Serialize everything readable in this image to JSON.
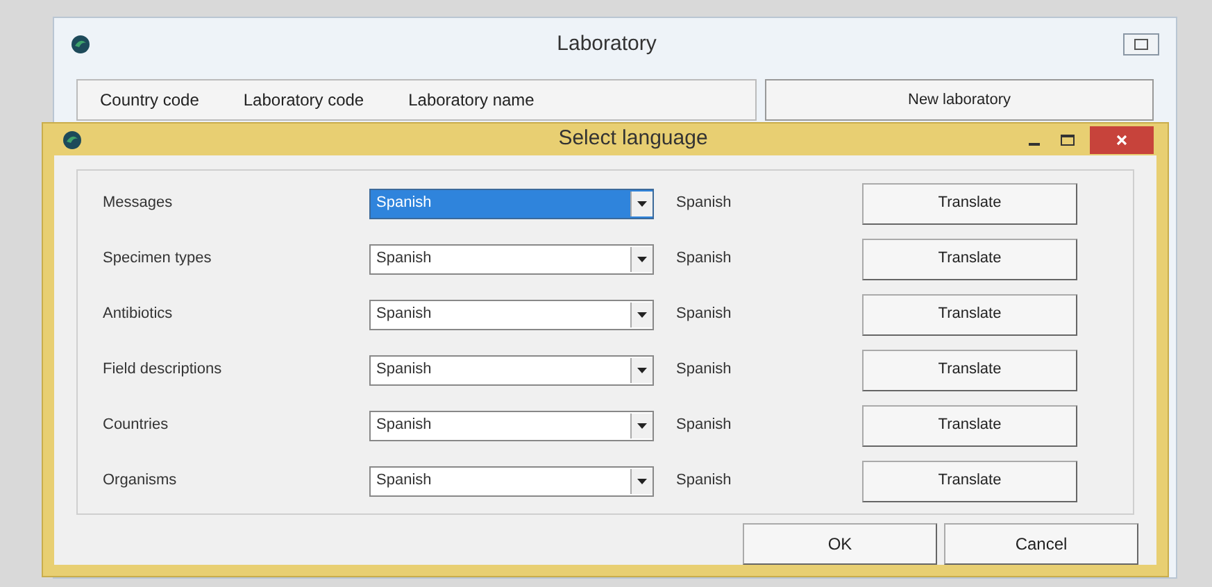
{
  "main_window": {
    "title": "Laboratory",
    "columns": [
      "Country code",
      "Laboratory code",
      "Laboratory name"
    ],
    "new_button": "New laboratory"
  },
  "dialog": {
    "title": "Select language",
    "rows": [
      {
        "label": "Messages",
        "value": "Spanish",
        "focused": true,
        "current": "Spanish",
        "button": "Translate"
      },
      {
        "label": "Specimen types",
        "value": "Spanish",
        "focused": false,
        "current": "Spanish",
        "button": "Translate"
      },
      {
        "label": "Antibiotics",
        "value": "Spanish",
        "focused": false,
        "current": "Spanish",
        "button": "Translate"
      },
      {
        "label": "Field descriptions",
        "value": "Spanish",
        "focused": false,
        "current": "Spanish",
        "button": "Translate"
      },
      {
        "label": "Countries",
        "value": "Spanish",
        "focused": false,
        "current": "Spanish",
        "button": "Translate"
      },
      {
        "label": "Organisms",
        "value": "Spanish",
        "focused": false,
        "current": "Spanish",
        "button": "Translate"
      }
    ],
    "buttons": [
      "OK",
      "Cancel"
    ]
  }
}
